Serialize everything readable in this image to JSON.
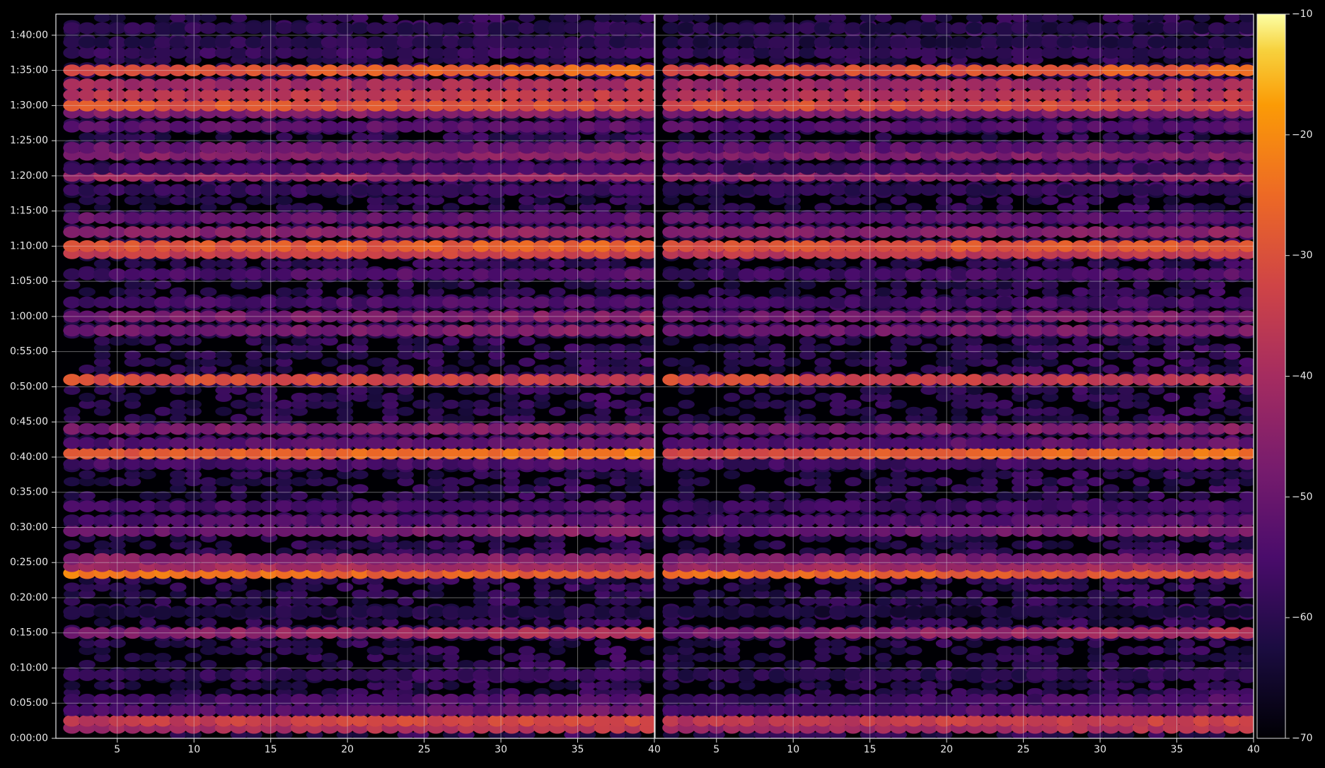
{
  "chart_data": {
    "type": "heatmap",
    "title": "",
    "xlabel": "",
    "ylabel": "",
    "colormap": "inferno",
    "background": "#000000",
    "grid": true,
    "panels": [
      {
        "name": "",
        "x_range": [
          1,
          40
        ],
        "x_ticks": [
          5,
          10,
          15,
          20,
          25,
          30,
          35,
          40
        ],
        "x_ticklabels": [
          "5",
          "10",
          "15",
          "20",
          "25",
          "30",
          "35",
          "40"
        ]
      },
      {
        "name": "",
        "x_range": [
          1,
          40
        ],
        "x_ticks": [
          5,
          10,
          15,
          20,
          25,
          30,
          35,
          40
        ],
        "x_ticklabels": [
          "5",
          "10",
          "15",
          "20",
          "25",
          "30",
          "35",
          "40"
        ]
      }
    ],
    "y_range_seconds": [
      0,
      6180
    ],
    "y_ticklabels": [
      "0:00:00",
      "0:05:00",
      "0:10:00",
      "0:15:00",
      "0:20:00",
      "0:25:00",
      "0:30:00",
      "0:35:00",
      "0:40:00",
      "0:45:00",
      "0:50:00",
      "0:55:00",
      "1:00:00",
      "1:05:00",
      "1:10:00",
      "1:15:00",
      "1:20:00",
      "1:25:00",
      "1:30:00",
      "1:35:00",
      "1:40:00"
    ],
    "y_tick_seconds": [
      0,
      300,
      600,
      900,
      1200,
      1500,
      1800,
      2100,
      2400,
      2700,
      3000,
      3300,
      3600,
      3900,
      4200,
      4500,
      4800,
      5100,
      5400,
      5700,
      6000
    ],
    "colorbar": {
      "range": [
        -70,
        -10
      ],
      "ticks": [
        -10,
        -20,
        -30,
        -40,
        -50,
        -60,
        -70
      ],
      "ticklabels": [
        "−10",
        "−20",
        "−30",
        "−40",
        "−50",
        "−60",
        "−70"
      ]
    },
    "bands": [
      {
        "t": 90,
        "level": -38,
        "p1_trend": 0.35,
        "p2_trend": 0.35
      },
      {
        "t": 150,
        "level": -33,
        "p1_trend": 0.25,
        "p2_trend": 0.2
      },
      {
        "t": 240,
        "level": -52,
        "p1_trend": 0.3,
        "p2_trend": 0.3
      },
      {
        "t": 330,
        "level": -55,
        "p1_trend": 0.2,
        "p2_trend": 0.25
      },
      {
        "t": 540,
        "level": -58,
        "p1_trend": 0.1,
        "p2_trend": 0.1
      },
      {
        "t": 900,
        "level": -42,
        "p1_trend": 0.55,
        "p2_trend": 0.55
      },
      {
        "t": 1080,
        "level": -62,
        "p1_trend": 0.0,
        "p2_trend": 0.0
      },
      {
        "t": 1410,
        "level": -26,
        "p1_trend": -0.4,
        "p2_trend": -0.4
      },
      {
        "t": 1470,
        "level": -40,
        "p1_trend": 0.1,
        "p2_trend": 0.1
      },
      {
        "t": 1530,
        "level": -46,
        "p1_trend": -0.1,
        "p2_trend": -0.1
      },
      {
        "t": 1770,
        "level": -48,
        "p1_trend": 0.35,
        "p2_trend": 0.35
      },
      {
        "t": 1860,
        "level": -53,
        "p1_trend": 0.3,
        "p2_trend": 0.3
      },
      {
        "t": 1980,
        "level": -55,
        "p1_trend": 0.2,
        "p2_trend": 0.2
      },
      {
        "t": 2340,
        "level": -55,
        "p1_trend": 0.1,
        "p2_trend": 0.1
      },
      {
        "t": 2430,
        "level": -26,
        "p1_trend": 0.45,
        "p2_trend": 0.45
      },
      {
        "t": 2520,
        "level": -52,
        "p1_trend": 0.25,
        "p2_trend": 0.25
      },
      {
        "t": 2640,
        "level": -46,
        "p1_trend": 0.2,
        "p2_trend": 0.2
      },
      {
        "t": 3060,
        "level": -33,
        "p1_trend": -0.3,
        "p2_trend": -0.3
      },
      {
        "t": 3480,
        "level": -47,
        "p1_trend": 0.2,
        "p2_trend": 0.2
      },
      {
        "t": 3600,
        "level": -47,
        "p1_trend": 0.2,
        "p2_trend": 0.2
      },
      {
        "t": 3720,
        "level": -55,
        "p1_trend": 0.1,
        "p2_trend": 0.1
      },
      {
        "t": 3960,
        "level": -54,
        "p1_trend": 0.25,
        "p2_trend": 0.25
      },
      {
        "t": 4140,
        "level": -34,
        "p1_trend": 0.1,
        "p2_trend": 0.1
      },
      {
        "t": 4200,
        "level": -28,
        "p1_trend": 0.2,
        "p2_trend": 0.2
      },
      {
        "t": 4320,
        "level": -44,
        "p1_trend": 0.1,
        "p2_trend": 0.1
      },
      {
        "t": 4440,
        "level": -51,
        "p1_trend": 0.0,
        "p2_trend": 0.0
      },
      {
        "t": 4680,
        "level": -58,
        "p1_trend": 0.1,
        "p2_trend": 0.1
      },
      {
        "t": 4800,
        "level": -42,
        "p1_trend": 0.0,
        "p2_trend": 0.0
      },
      {
        "t": 4860,
        "level": -56,
        "p1_trend": 0.1,
        "p2_trend": 0.1
      },
      {
        "t": 4980,
        "level": -45,
        "p1_trend": 0.1,
        "p2_trend": 0.1
      },
      {
        "t": 5040,
        "level": -50,
        "p1_trend": 0.05,
        "p2_trend": 0.05
      },
      {
        "t": 5220,
        "level": -52,
        "p1_trend": 0.0,
        "p2_trend": 0.0
      },
      {
        "t": 5340,
        "level": -46,
        "p1_trend": 0.0,
        "p2_trend": 0.0
      },
      {
        "t": 5400,
        "level": -30,
        "p1_trend": -0.1,
        "p2_trend": -0.1
      },
      {
        "t": 5490,
        "level": -36,
        "p1_trend": 0.1,
        "p2_trend": 0.1
      },
      {
        "t": 5580,
        "level": -40,
        "p1_trend": 0.1,
        "p2_trend": 0.1
      },
      {
        "t": 5700,
        "level": -28,
        "p1_trend": 0.3,
        "p2_trend": 0.3
      },
      {
        "t": 5850,
        "level": -58,
        "p1_trend": 0.0,
        "p2_trend": 0.0
      },
      {
        "t": 5940,
        "level": -60,
        "p1_trend": 0.0,
        "p2_trend": 0.0
      },
      {
        "t": 6060,
        "level": -60,
        "p1_trend": 0.0,
        "p2_trend": 0.0
      }
    ]
  }
}
